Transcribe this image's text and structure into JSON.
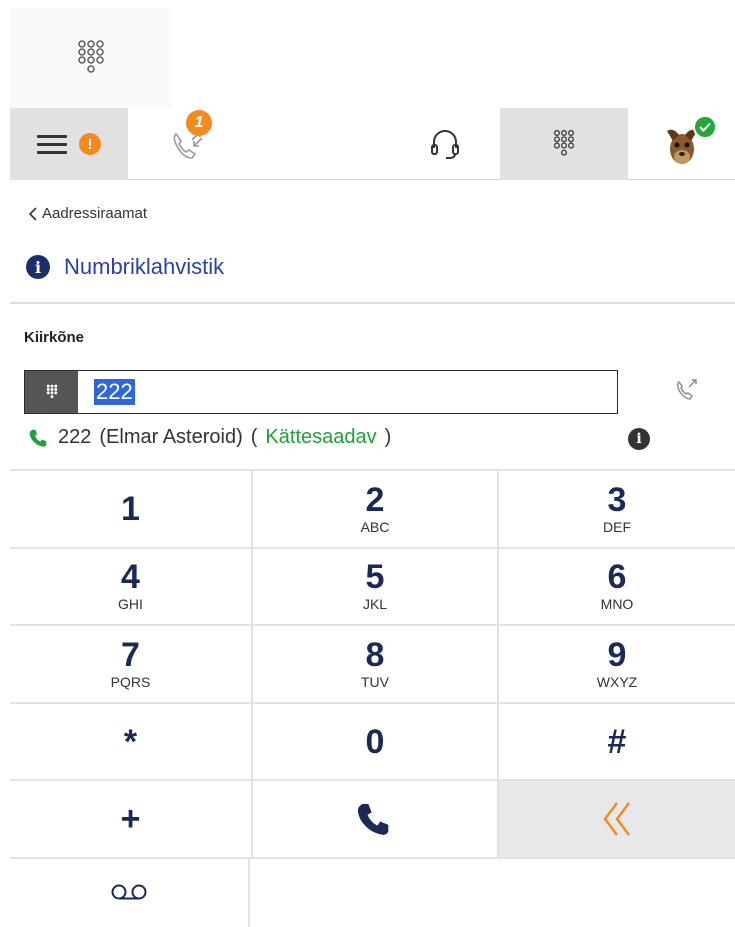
{
  "topbar": {
    "missed_calls_badge": "1",
    "warning_badge": "!",
    "icons": [
      "dialpad-icon",
      "hamburger-icon",
      "warning-icon",
      "calls-icon",
      "headset-icon",
      "dialpad-icon",
      "avatar"
    ],
    "accent_color": "#f28a1f",
    "online_color": "#22a83d"
  },
  "nav": {
    "back_label": "Aadressiraamat",
    "section_title": "Numbriklahvistik"
  },
  "quick_call": {
    "label": "Kiirkõne",
    "input_value": "222"
  },
  "contact": {
    "number": "222",
    "name": "(Elmar Asteroid)",
    "status_open": "(",
    "status": "Kättesaadav",
    "status_close": ")",
    "status_color": "#21a03a"
  },
  "keypad": [
    {
      "digit": "1",
      "letters": ""
    },
    {
      "digit": "2",
      "letters": "ABC"
    },
    {
      "digit": "3",
      "letters": "DEF"
    },
    {
      "digit": "4",
      "letters": "GHI"
    },
    {
      "digit": "5",
      "letters": "JKL"
    },
    {
      "digit": "6",
      "letters": "MNO"
    },
    {
      "digit": "7",
      "letters": "PQRS"
    },
    {
      "digit": "8",
      "letters": "TUV"
    },
    {
      "digit": "9",
      "letters": "WXYZ"
    },
    {
      "digit": "*",
      "letters": ""
    },
    {
      "digit": "0",
      "letters": ""
    },
    {
      "digit": "#",
      "letters": ""
    },
    {
      "digit": "+",
      "letters": ""
    }
  ]
}
